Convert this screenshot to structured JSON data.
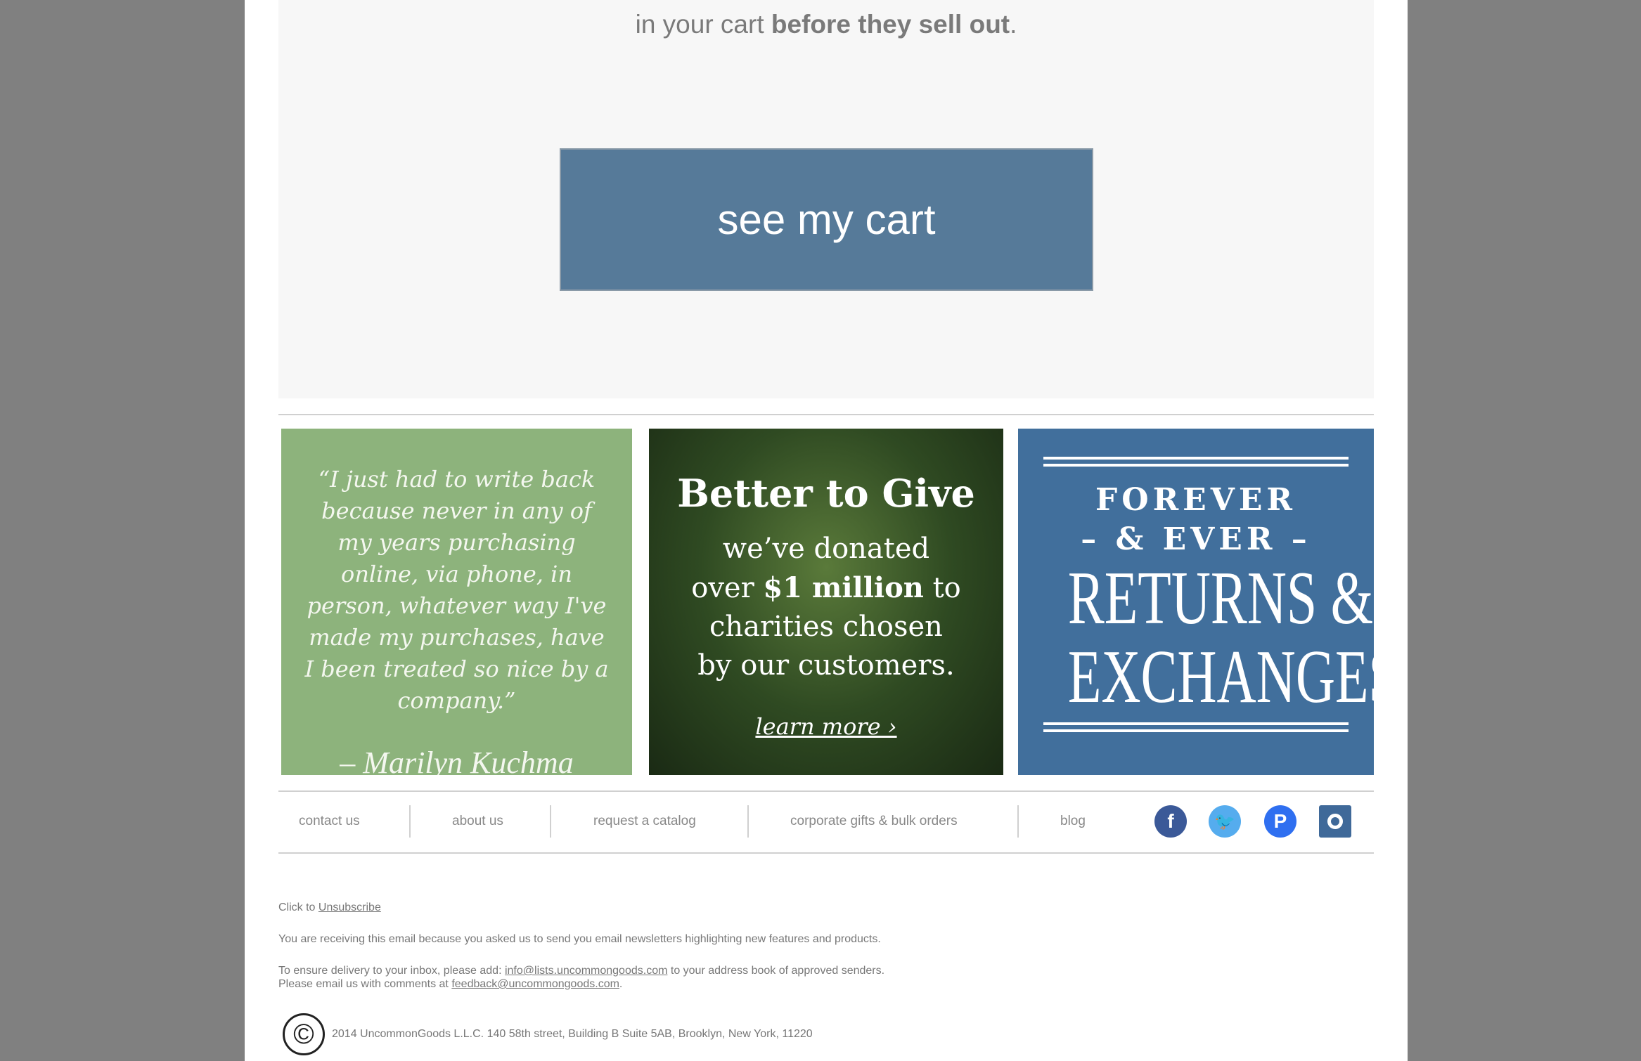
{
  "headline": {
    "normal": "in your cart ",
    "bold": "before they sell out",
    "end": "."
  },
  "cta": {
    "label": "see my cart"
  },
  "tiles": {
    "testimonial": {
      "quote": "“I just had to write back because never in any of my years purchasing online, via phone, in person, whatever way I've made my purchases, have I been treated so nice by a company.”",
      "signature": "– Marilyn Kuchma"
    },
    "charity": {
      "title": "Better to Give",
      "line1": "we’ve donated",
      "line2a": "over ",
      "line2b": "$1 million",
      "line2c": " to",
      "line3": "charities chosen",
      "line4": "by our customers.",
      "link": "learn more ›"
    },
    "returns": {
      "line1": "FOREVER",
      "line2": "– & EVER –",
      "line3": "RETURNS &",
      "line4": "EXCHANGES"
    }
  },
  "nav": {
    "items": [
      "contact us",
      "about us",
      "request a catalog",
      "corporate gifts & bulk orders",
      "blog"
    ]
  },
  "social": {
    "icons": [
      "facebook-icon",
      "twitter-icon",
      "pinterest-icon",
      "instagram-icon"
    ],
    "colors": {
      "facebook": "#3b5998",
      "twitter": "#55acee",
      "pinterest": "#2f6ff0",
      "instagram": "#3f6999"
    }
  },
  "footer": {
    "unsub_prefix": "Click to ",
    "unsub_link": "Unsubscribe",
    "receiving": "You are receiving this email because you asked us to send you email newsletters highlighting new features and products.",
    "ensure_prefix": "To ensure delivery to your inbox, please add: ",
    "ensure_email": "info@lists.uncommongoods.com",
    "ensure_suffix": " to your address book of approved senders.",
    "comments_prefix": "Please email us with comments at ",
    "comments_email": "feedback@uncommongoods.com",
    "comments_suffix": ".",
    "copyright_symbol": "©",
    "copyright": "2014 UncommonGoods L.L.C. 140 58th street, Building B Suite 5AB, Brooklyn, New York, 11220"
  }
}
